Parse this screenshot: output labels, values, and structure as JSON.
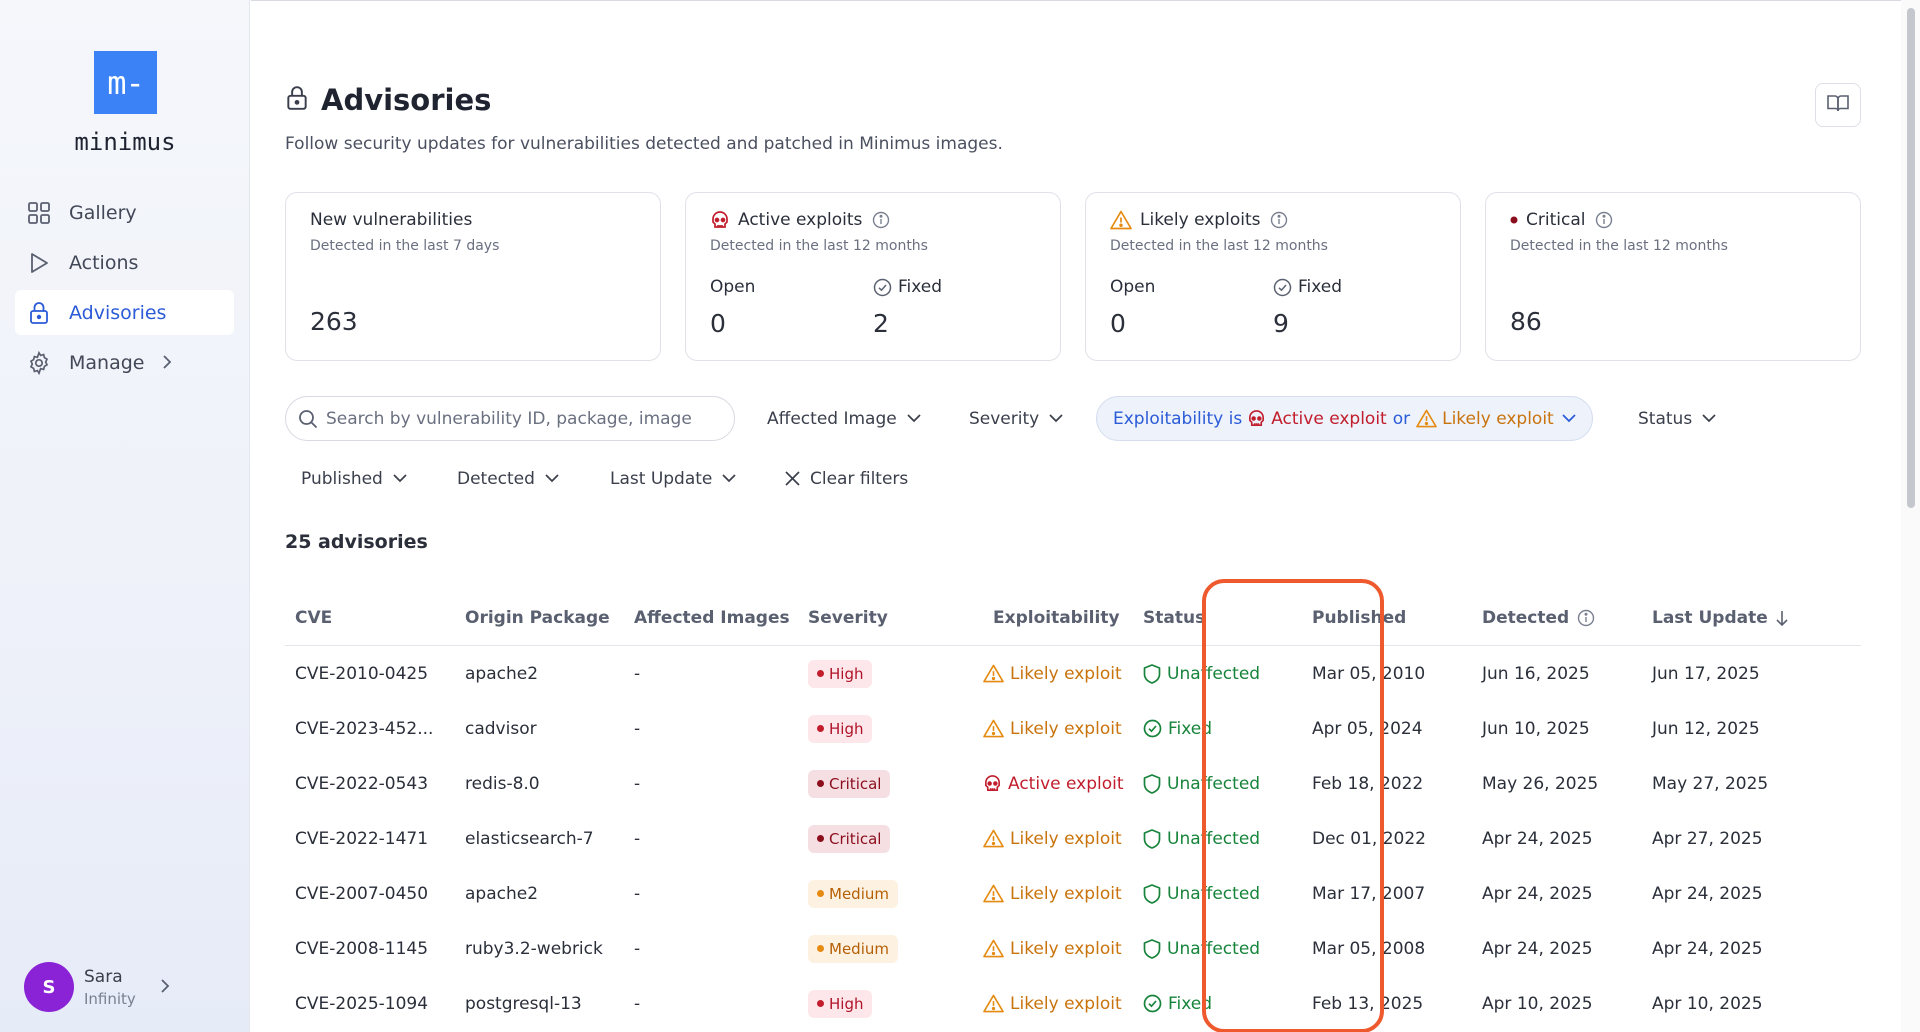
{
  "sidebar": {
    "logo_mark": "m-",
    "logo_text": "minimus",
    "items": [
      {
        "label": "Gallery",
        "icon": "grid-icon"
      },
      {
        "label": "Actions",
        "icon": "play-icon"
      },
      {
        "label": "Advisories",
        "icon": "lock-icon"
      },
      {
        "label": "Manage",
        "icon": "gear-icon"
      }
    ],
    "user": {
      "initial": "S",
      "name": "Sara",
      "org": "Infinity"
    }
  },
  "header": {
    "title": "Advisories",
    "subtitle": "Follow security updates for vulnerabilities detected and patched in Minimus images."
  },
  "cards": {
    "new": {
      "title": "New vulnerabilities",
      "sub": "Detected in the last 7 days",
      "value": "263"
    },
    "active": {
      "title": "Active exploits",
      "sub": "Detected in the last 12 months",
      "open_label": "Open",
      "open_value": "0",
      "fixed_label": "Fixed",
      "fixed_value": "2"
    },
    "likely": {
      "title": "Likely exploits",
      "sub": "Detected in the last 12 months",
      "open_label": "Open",
      "open_value": "0",
      "fixed_label": "Fixed",
      "fixed_value": "9"
    },
    "critical": {
      "title": "Critical",
      "sub": "Detected in the last 12 months",
      "value": "86"
    }
  },
  "filters": {
    "search_placeholder": "Search by vulnerability ID, package, image",
    "affected_image": "Affected Image",
    "severity": "Severity",
    "exploit_chip": {
      "prefix": "Exploitability is",
      "active": "Active exploit",
      "or": "or",
      "likely": "Likely exploit"
    },
    "status": "Status",
    "published": "Published",
    "detected": "Detected",
    "last_update": "Last Update",
    "clear": "Clear filters"
  },
  "count_label": "25 advisories",
  "table": {
    "headers": [
      "CVE",
      "Origin Package",
      "Affected Images",
      "Severity",
      "Exploitability",
      "Status",
      "Published",
      "Detected",
      "Last Update"
    ],
    "rows": [
      {
        "cve": "CVE-2010-0425",
        "pkg": "apache2",
        "images": "-",
        "severity": "High",
        "exploit": "Likely exploit",
        "status": "Unaffected",
        "published": "Mar 05, 2010",
        "detected": "Jun 16, 2025",
        "updated": "Jun 17, 2025"
      },
      {
        "cve": "CVE-2023-452...",
        "pkg": "cadvisor",
        "images": "-",
        "severity": "High",
        "exploit": "Likely exploit",
        "status": "Fixed",
        "published": "Apr 05, 2024",
        "detected": "Jun 10, 2025",
        "updated": "Jun 12, 2025"
      },
      {
        "cve": "CVE-2022-0543",
        "pkg": "redis-8.0",
        "images": "-",
        "severity": "Critical",
        "exploit": "Active exploit",
        "status": "Unaffected",
        "published": "Feb 18, 2022",
        "detected": "May 26, 2025",
        "updated": "May 27, 2025"
      },
      {
        "cve": "CVE-2022-1471",
        "pkg": "elasticsearch-7",
        "images": "-",
        "severity": "Critical",
        "exploit": "Likely exploit",
        "status": "Unaffected",
        "published": "Dec 01, 2022",
        "detected": "Apr 24, 2025",
        "updated": "Apr 27, 2025"
      },
      {
        "cve": "CVE-2007-0450",
        "pkg": "apache2",
        "images": "-",
        "severity": "Medium",
        "exploit": "Likely exploit",
        "status": "Unaffected",
        "published": "Mar 17, 2007",
        "detected": "Apr 24, 2025",
        "updated": "Apr 24, 2025"
      },
      {
        "cve": "CVE-2008-1145",
        "pkg": "ruby3.2-webrick",
        "images": "-",
        "severity": "Medium",
        "exploit": "Likely exploit",
        "status": "Unaffected",
        "published": "Mar 05, 2008",
        "detected": "Apr 24, 2025",
        "updated": "Apr 24, 2025"
      },
      {
        "cve": "CVE-2025-1094",
        "pkg": "postgresql-13",
        "images": "-",
        "severity": "High",
        "exploit": "Likely exploit",
        "status": "Fixed",
        "published": "Feb 13, 2025",
        "detected": "Apr 10, 2025",
        "updated": "Apr 10, 2025"
      }
    ]
  },
  "colors": {
    "accent": "#2b5bd7",
    "logo": "#3b82f6",
    "high": "#c21d2c",
    "critical": "#8b0e1d",
    "medium": "#e58b12",
    "likely": "#c9730c",
    "fixed": "#17843b",
    "highlight": "#ee5a2e",
    "avatar": "#8a23d6"
  }
}
